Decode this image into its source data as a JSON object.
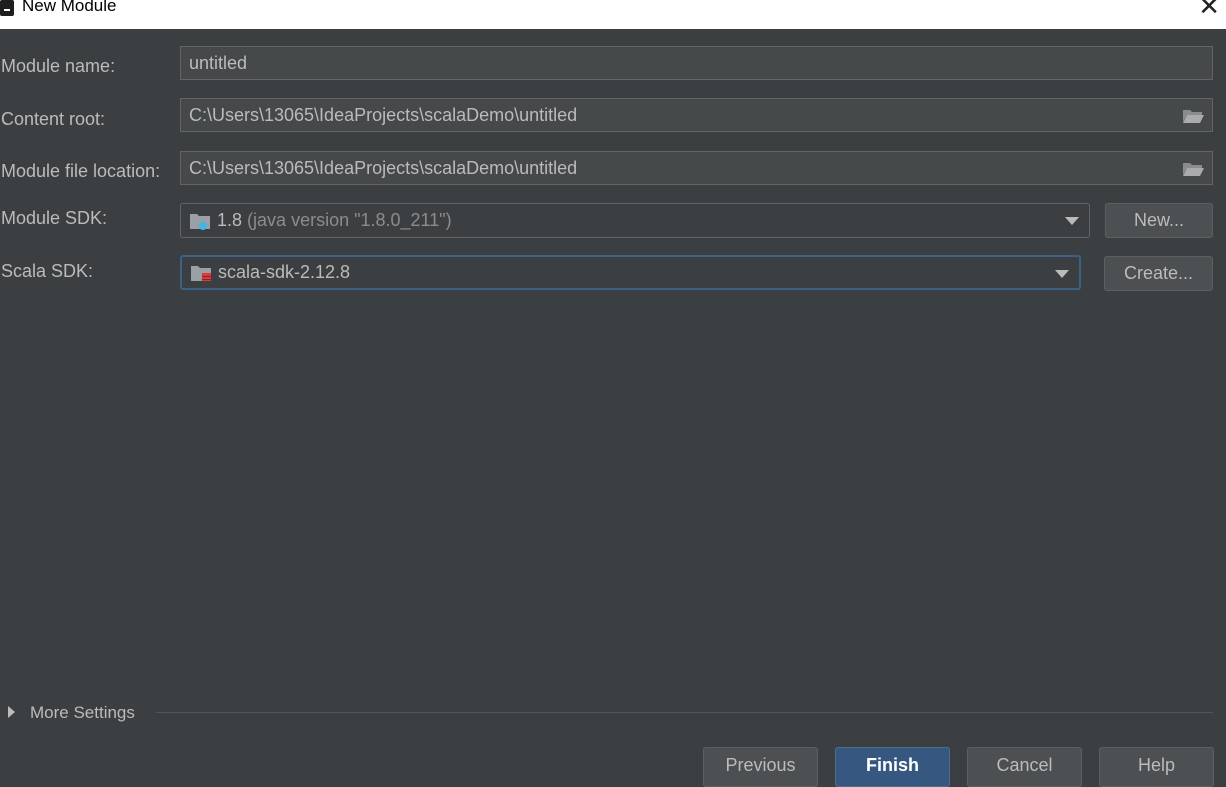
{
  "window": {
    "title": "New Module",
    "close_icon": "close-icon"
  },
  "form": {
    "module_name": {
      "label": "Module name:",
      "value": "untitled"
    },
    "content_root": {
      "label": "Content root:",
      "value": "C:\\Users\\13065\\IdeaProjects\\scalaDemo\\untitled",
      "icon": "folder-open-icon"
    },
    "module_file_location": {
      "label": "Module file location:",
      "value": "C:\\Users\\13065\\IdeaProjects\\scalaDemo\\untitled",
      "icon": "folder-open-icon"
    },
    "module_sdk": {
      "label": "Module SDK:",
      "value": "1.8",
      "detail": "(java version \"1.8.0_211\")",
      "icon": "jdk-folder-icon",
      "button": "New..."
    },
    "scala_sdk": {
      "label": "Scala SDK:",
      "value": "scala-sdk-2.12.8",
      "icon": "library-folder-icon",
      "button": "Create..."
    }
  },
  "more_settings": {
    "label": "More Settings"
  },
  "buttons": {
    "previous": "Previous",
    "finish": "Finish",
    "cancel": "Cancel",
    "help": "Help"
  },
  "colors": {
    "background": "#3c3f41",
    "field_background": "#45494a",
    "focus_border": "#3d6185",
    "primary_button": "#365880",
    "text": "#bbbbbb"
  }
}
